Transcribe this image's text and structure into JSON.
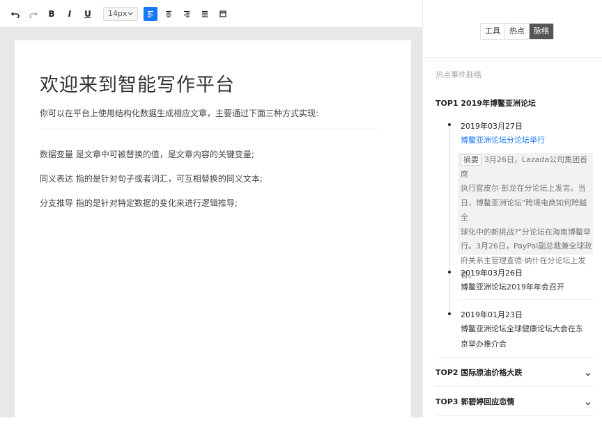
{
  "toolbar": {
    "undo": "undo-icon",
    "redo": "redo-icon",
    "bold": "B",
    "italic": "I",
    "underline": "U",
    "font_size": "14px",
    "align_left": "align-left-icon",
    "align_center": "align-center-icon",
    "align_right": "align-right-icon",
    "align_justify": "align-justify-icon",
    "table": "table-icon"
  },
  "document": {
    "title": "欢迎来到智能写作平台",
    "intro": "你可以在平台上使用结构化数据生成相应文章，主要通过下面三种方式实现:",
    "paragraphs": [
      "数据变量 是文章中可被替换的值，是文章内容的关键变量;",
      "同义表达 指的是针对句子或者词汇，可互相替换的同义文本;",
      "分支推导 指的是针对特定数据的变化来进行逻辑推导;"
    ]
  },
  "panel": {
    "tabs": [
      "工具",
      "热点",
      "脉络"
    ],
    "active_tab": "脉络",
    "section_title": "热点事件脉络",
    "top1": {
      "title": "TOP1 2019年博鳌亚洲论坛",
      "events": [
        {
          "date": "2019年03月27日",
          "title": "博鳌亚洲论坛分论坛举行"
        },
        {
          "date": "2019年03月26日",
          "title": "博鳌亚洲论坛2019年年会召开"
        },
        {
          "date": "2019年01月23日",
          "title_line1": "博鳌亚洲论坛全球健康论坛大会在东",
          "title_line2": "京举办推介会"
        }
      ],
      "summary_tag": "摘要",
      "summary_lines": [
        "3月26日，Lazada公司集团首席",
        "执行官皮尔·彭龙在分论坛上发言。当",
        "日，博鳌亚洲论坛\"跨境电商如何跨越全",
        "球化中的新挑战?\"分论坛在海南博鳌举",
        "行。3月26日，PayPal副总裁兼全球政",
        "府关系主管理查德·纳什在分论坛上发",
        "言。"
      ]
    },
    "others": [
      {
        "title": "TOP2 国际原油价格大跌"
      },
      {
        "title": "TOP3 郭碧婷回应恋情"
      }
    ],
    "colors": {
      "link": "#1677ff",
      "active_tab_bg": "#555555",
      "align_active": "#1677ff"
    }
  }
}
